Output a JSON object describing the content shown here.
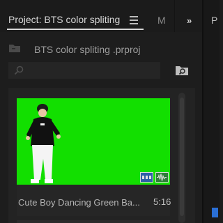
{
  "tabs": {
    "active_label": "Project: BTS color spliting",
    "next_label": "M",
    "overflow_label": "»",
    "right_label": "P"
  },
  "project": {
    "filename": "BTS color spliting .prproj"
  },
  "search": {
    "placeholder": ""
  },
  "clip": {
    "name": "Cute Boy Dancing Green Ba...",
    "duration": "5:16"
  },
  "colors": {
    "accent": "#2a6fd6",
    "greenscreen": "#12df00"
  }
}
